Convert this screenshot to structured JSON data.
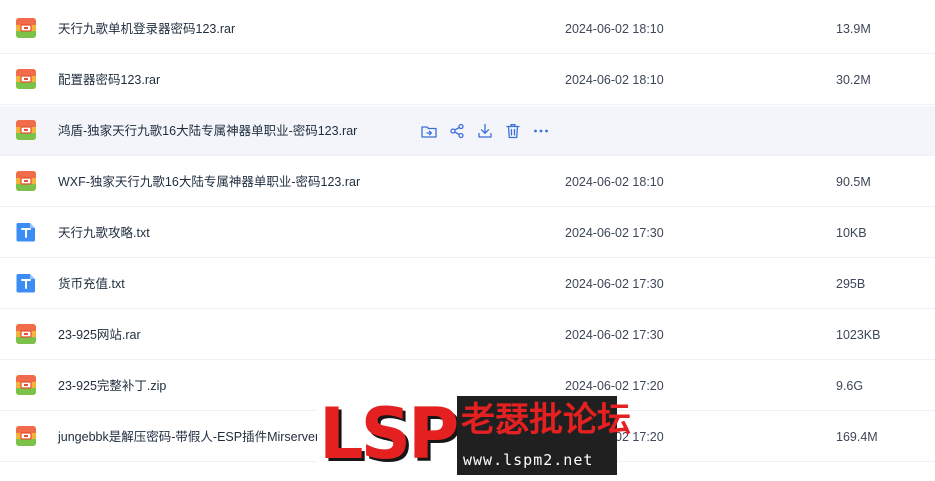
{
  "file_list": {
    "rows": [
      {
        "name": "天行九歌单机登录器密码123.rar",
        "date": "2024-06-02 18:10",
        "size": "13.9M",
        "type": "archive"
      },
      {
        "name": "配置器密码123.rar",
        "date": "2024-06-02 18:10",
        "size": "30.2M",
        "type": "archive"
      },
      {
        "name": "鸿盾-独家天行九歌16大陆专属神器单职业-密码123.rar",
        "date": "",
        "size": "",
        "type": "archive"
      },
      {
        "name": "WXF-独家天行九歌16大陆专属神器单职业-密码123.rar",
        "date": "2024-06-02 18:10",
        "size": "90.5M",
        "type": "archive"
      },
      {
        "name": "天行九歌攻略.txt",
        "date": "2024-06-02 17:30",
        "size": "10KB",
        "type": "text"
      },
      {
        "name": "货币充值.txt",
        "date": "2024-06-02 17:30",
        "size": "295B",
        "type": "text"
      },
      {
        "name": "23-925网站.rar",
        "date": "2024-06-02 17:30",
        "size": "1023KB",
        "type": "archive"
      },
      {
        "name": "23-925完整补丁.zip",
        "date": "2024-06-02 17:20",
        "size": "9.6G",
        "type": "archive"
      },
      {
        "name": "jungebbk是解压密码-带假人-ESP插件Mirserver",
        "date": "2024-06-02 17:20",
        "size": "169.4M",
        "type": "archive"
      }
    ],
    "hovered_row": 2,
    "row_actions": [
      {
        "icon": "move-to-folder-icon"
      },
      {
        "icon": "share-icon"
      },
      {
        "icon": "download-icon"
      },
      {
        "icon": "delete-icon"
      },
      {
        "icon": "more-icon"
      }
    ]
  },
  "watermark": {
    "logo_text": "LSP",
    "site_name": "老瑟批论坛",
    "url": "www.lspm2.net",
    "accent_color": "#e52020"
  },
  "colors": {
    "archive_icon": "#7bc14a",
    "text_icon": "#3b8cf5",
    "action_icon": "#3b6fd8"
  }
}
